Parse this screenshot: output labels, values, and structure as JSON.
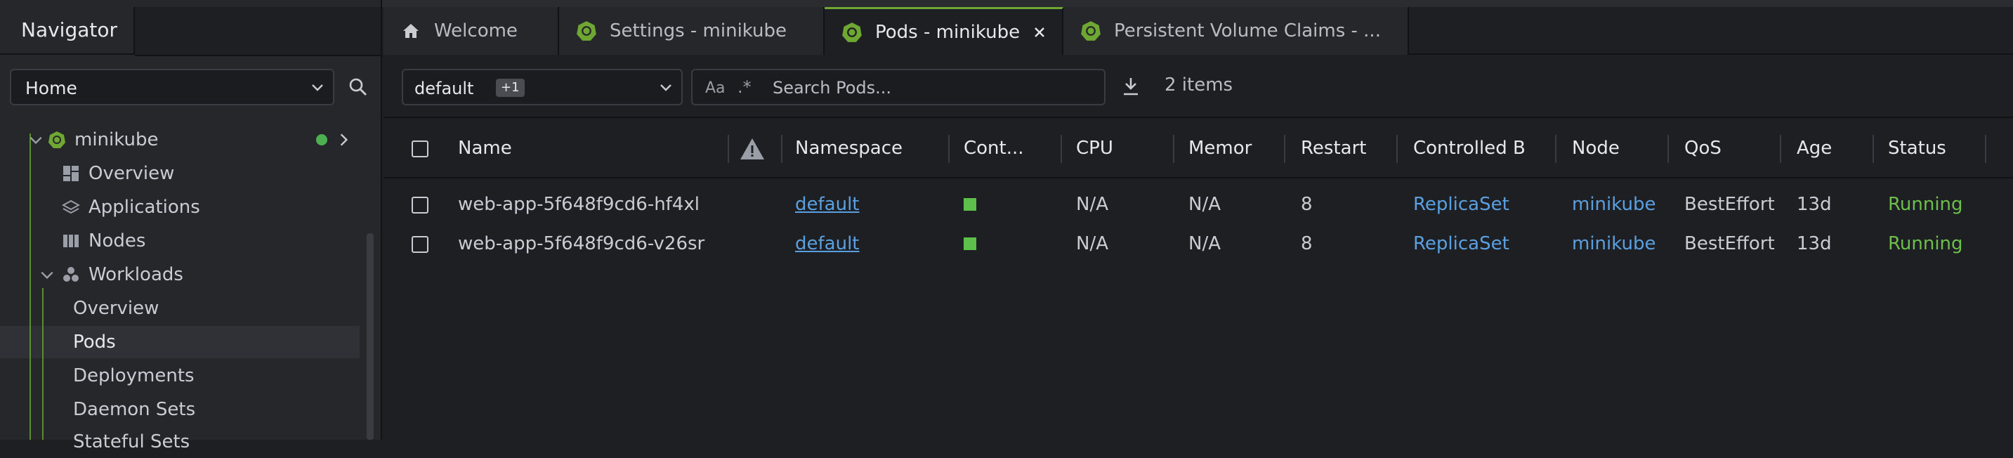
{
  "sidebar": {
    "title": "Navigator",
    "context_select": "Home",
    "tree": [
      {
        "label": "minikube",
        "icon": "kubernetes-icon"
      },
      {
        "label": "Overview",
        "icon": "overview-grid-icon"
      },
      {
        "label": "Applications",
        "icon": "applications-icon"
      },
      {
        "label": "Nodes",
        "icon": "nodes-icon"
      },
      {
        "label": "Workloads",
        "icon": "workloads-icon"
      },
      {
        "label": "Overview"
      },
      {
        "label": "Pods"
      },
      {
        "label": "Deployments"
      },
      {
        "label": "Daemon Sets"
      },
      {
        "label": "Stateful Sets"
      }
    ]
  },
  "tabs": [
    {
      "label": "Welcome",
      "icon": "home-icon"
    },
    {
      "label": "Settings - minikube",
      "icon": "kubernetes-icon"
    },
    {
      "label": "Pods - minikube",
      "icon": "kubernetes-icon"
    },
    {
      "label": "Persistent Volume Claims - ...",
      "icon": "kubernetes-icon"
    }
  ],
  "toolbar": {
    "namespace_value": "default",
    "namespace_badge": "+1",
    "case_toggle": "Aa",
    "regex_toggle": ".*",
    "search_placeholder": "Search Pods...",
    "items_count": "2 items"
  },
  "table": {
    "columns": [
      "Name",
      "Namespace",
      "Cont...",
      "CPU",
      "Memor",
      "Restart",
      "Controlled B",
      "Node",
      "QoS",
      "Age",
      "Status"
    ],
    "rows": [
      {
        "name": "web-app-5f648f9cd6-hf4xl",
        "namespace": "default",
        "cpu": "N/A",
        "memory": "N/A",
        "restarts": "8",
        "controlled_by": "ReplicaSet",
        "node": "minikube",
        "qos": "BestEffort",
        "age": "13d",
        "status": "Running"
      },
      {
        "name": "web-app-5f648f9cd6-v26sr",
        "namespace": "default",
        "cpu": "N/A",
        "memory": "N/A",
        "restarts": "8",
        "controlled_by": "ReplicaSet",
        "node": "minikube",
        "qos": "BestEffort",
        "age": "13d",
        "status": "Running"
      }
    ]
  },
  "colors": {
    "accent": "#6ea832",
    "link": "#5aa0e0",
    "running": "#6cbf4a",
    "container_ok": "#5cc04a"
  }
}
